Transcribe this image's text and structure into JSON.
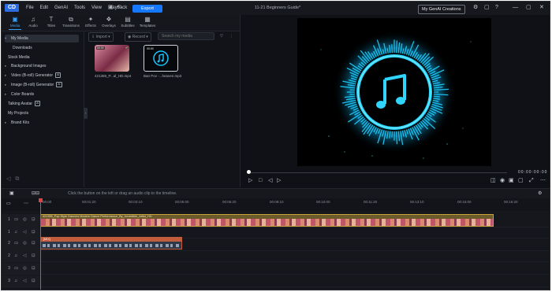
{
  "app": {
    "logo": "CD",
    "menu": [
      "File",
      "Edit",
      "GenAI",
      "Tools",
      "View",
      "Playback"
    ],
    "export_label": "Export",
    "window_title": "11-21 Beginners Guide*",
    "creations_label": "My GenAI Creations"
  },
  "tabs": [
    {
      "label": "Media",
      "icon": "media-icon"
    },
    {
      "label": "Audio",
      "icon": "music-icon"
    },
    {
      "label": "Titles",
      "icon": "title-icon"
    },
    {
      "label": "Transitions",
      "icon": "transition-icon"
    },
    {
      "label": "Effects",
      "icon": "effects-icon"
    },
    {
      "label": "Overlays",
      "icon": "overlays-icon"
    },
    {
      "label": "Subtitles",
      "icon": "subtitles-icon"
    },
    {
      "label": "Templates",
      "icon": "templates-icon"
    }
  ],
  "sidebar": {
    "items": [
      {
        "label": "My Media",
        "caret": "▾"
      },
      {
        "label": "Downloads",
        "caret": ""
      },
      {
        "label": "Stock Media",
        "caret": ""
      },
      {
        "label": "Background Images",
        "caret": "▸"
      },
      {
        "label": "Video (B-roll) Generator",
        "caret": "▸"
      },
      {
        "label": "Image (B-roll) Generator",
        "caret": "▸"
      },
      {
        "label": "Color Boards",
        "caret": "▸"
      },
      {
        "label": "Talking Avatar",
        "caret": ""
      },
      {
        "label": "My Projects",
        "caret": ""
      },
      {
        "label": "Brand Kits",
        "caret": "▸"
      }
    ]
  },
  "media_toolbar": {
    "import_label": "Import",
    "record_label": "Record",
    "search_placeholder": "Search my media"
  },
  "media_items": [
    {
      "name": "421359_P...al_HD.mp4",
      "duration": "00:00",
      "checked": true
    },
    {
      "name": "Ban Pov -...heaven.mp3",
      "duration": "00:00",
      "checked": false
    }
  ],
  "preview": {
    "timecode": "00:00:00:00"
  },
  "timeline": {
    "hint": "Click the button on the left or drag an audio clip to the timeline.",
    "ruler": [
      "00:00",
      "00:01:20",
      "00:03:10",
      "00:05:00",
      "00:06:20",
      "00:08:10",
      "00:10:00",
      "00:11:20",
      "00:13:10",
      "00:15:00",
      "00:16:20"
    ],
    "video_clip_label": "421359_Pop Style Dancers Modern Dance Performance_By_Incredible_Artist_HD",
    "audio_clip_label": "[MIX]",
    "tracks": [
      {
        "num": "1",
        "icon": "▭"
      },
      {
        "num": "1",
        "icon": "♫"
      },
      {
        "num": "2",
        "icon": "▭"
      },
      {
        "num": "2",
        "icon": "♫"
      },
      {
        "num": "3",
        "icon": "▭"
      },
      {
        "num": "3",
        "icon": "♫"
      }
    ]
  },
  "colors": {
    "accent": "#1677ff",
    "glow": "#17c8ff",
    "video_clip": "#c9a63c",
    "audio_clip": "#c15c3d"
  }
}
